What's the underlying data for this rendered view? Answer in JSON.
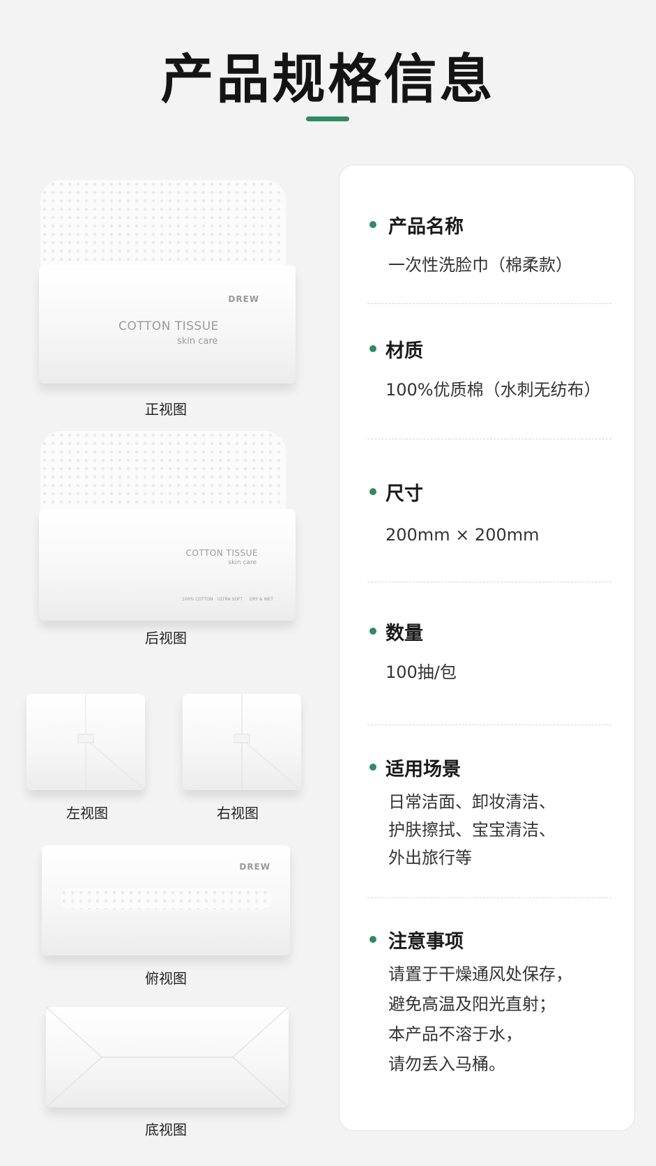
{
  "header": {
    "title": "产品规格信息",
    "accent_color": "#2e8b62"
  },
  "views": {
    "front_label": "正视图",
    "back_label": "后视图",
    "left_label": "左视图",
    "right_label": "右视图",
    "top_label": "俯视图",
    "bottom_label": "底视图"
  },
  "package": {
    "brand": "DREW",
    "name": "COTTON TISSUE",
    "sub": "skin care",
    "back_name": "COTTON TISSUE",
    "back_sub": "skin care",
    "badges": [
      "100% COTTON",
      "ULTRA SOFT",
      "DRY & WET"
    ]
  },
  "specs": [
    {
      "label": "产品名称",
      "lines": [
        "一次性洗脸巾（棉柔款）"
      ]
    },
    {
      "label": "材质",
      "lines": [
        "100%优质棉（水刺无纺布）"
      ]
    },
    {
      "label": "尺寸",
      "lines": [
        "200mm × 200mm"
      ]
    },
    {
      "label": "数量",
      "lines": [
        "100抽/包"
      ]
    },
    {
      "label": "适用场景",
      "lines": [
        "日常洁面、卸妆清洁、",
        "护肤擦拭、宝宝清洁、",
        "外出旅行等"
      ]
    },
    {
      "label": "注意事项",
      "lines": [
        "请置于干燥通风处保存，",
        "避免高温及阳光直射；",
        "本产品不溶于水，",
        "请勿丢入马桶。"
      ]
    }
  ]
}
